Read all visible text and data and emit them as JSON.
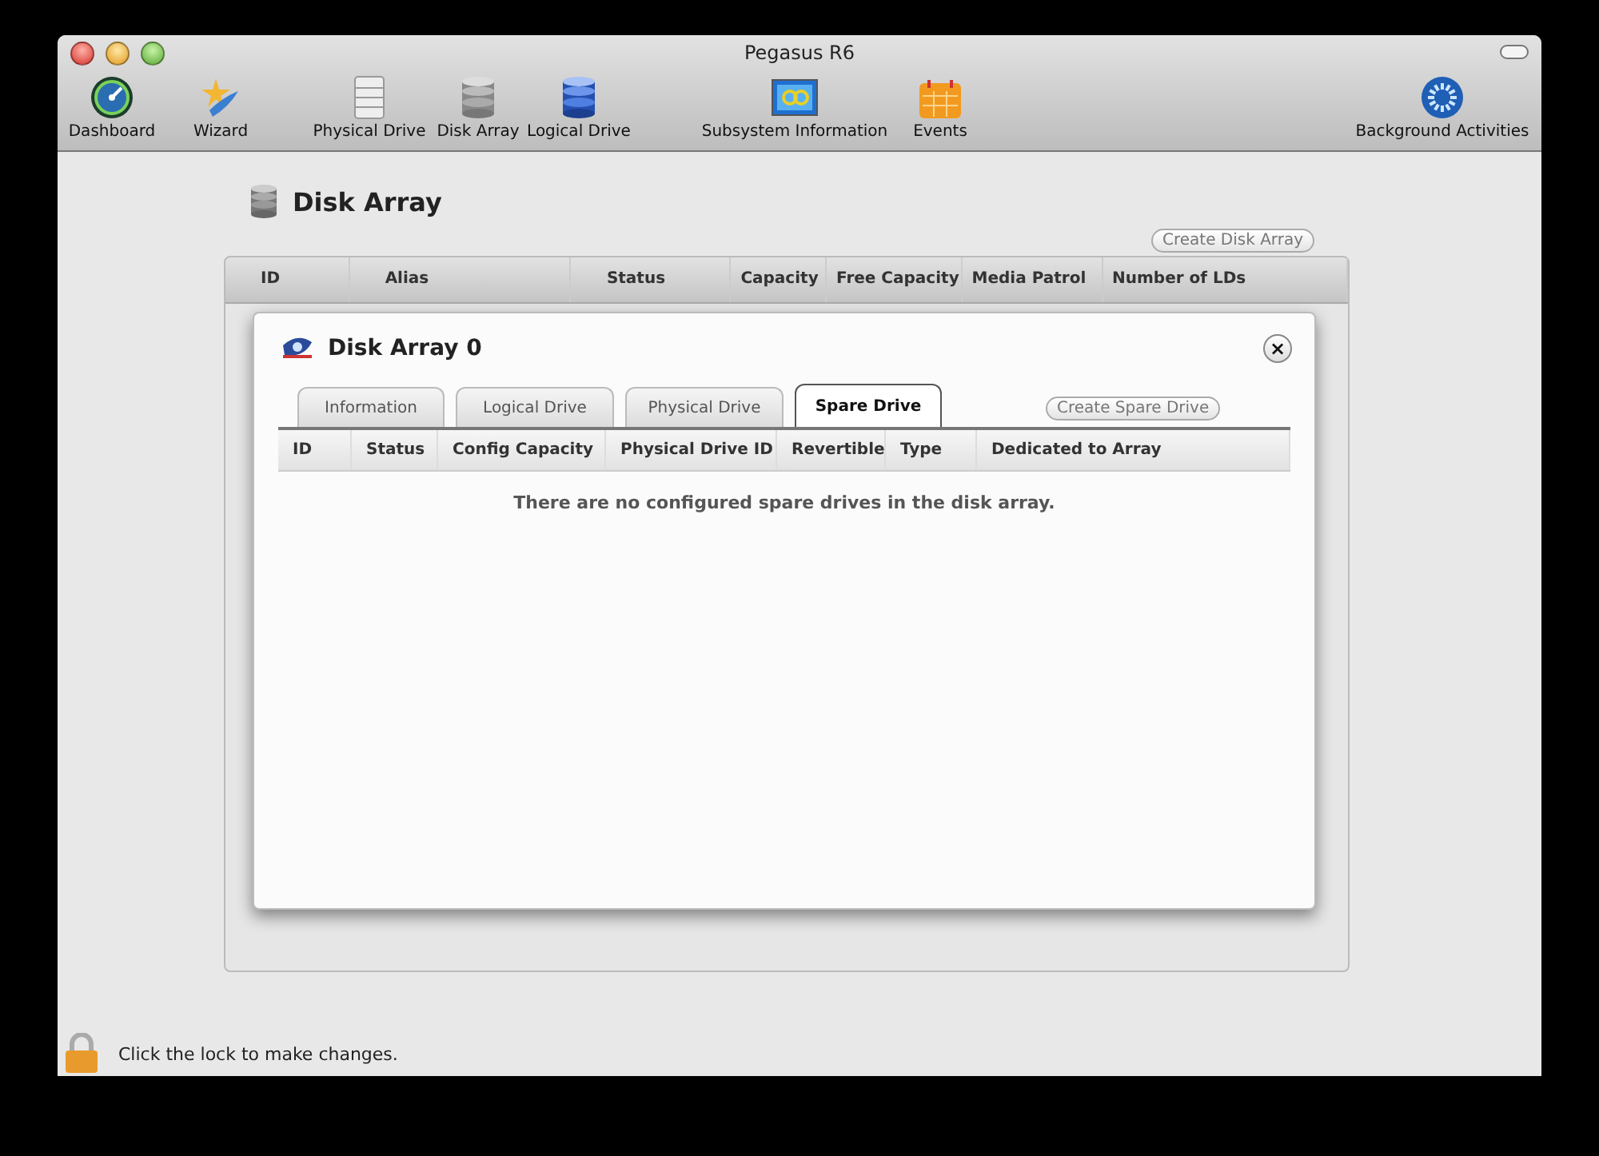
{
  "window": {
    "title": "Pegasus R6"
  },
  "toolbar": [
    {
      "label": "Dashboard"
    },
    {
      "label": "Wizard"
    },
    {
      "label": "Physical Drive"
    },
    {
      "label": "Disk Array"
    },
    {
      "label": "Logical Drive"
    },
    {
      "label": "Subsystem Information"
    },
    {
      "label": "Events"
    },
    {
      "label": "Background Activities"
    }
  ],
  "page": {
    "heading": "Disk Array",
    "create_button": "Create Disk Array",
    "table": {
      "columns": [
        "ID",
        "Alias",
        "Status",
        "Capacity",
        "Free Capacity",
        "Media Patrol",
        "Number of LDs"
      ]
    }
  },
  "dialog": {
    "title": "Disk Array 0",
    "close": "×",
    "tabs": [
      {
        "label": "Information",
        "selected": false
      },
      {
        "label": "Logical Drive",
        "selected": false
      },
      {
        "label": "Physical Drive",
        "selected": false
      },
      {
        "label": "Spare Drive",
        "selected": true
      }
    ],
    "create_button": "Create Spare Drive",
    "table": {
      "columns": [
        "ID",
        "Status",
        "Config Capacity",
        "Physical Drive ID",
        "Revertible",
        "Type",
        "Dedicated to Array"
      ],
      "empty_message": "There are no configured spare drives in the disk array."
    }
  },
  "status_bar": {
    "text": "Click the lock to make changes."
  }
}
